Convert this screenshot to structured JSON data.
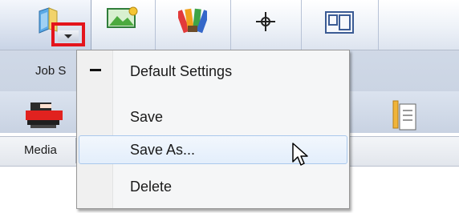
{
  "toolbar": {
    "group_label": "Job S",
    "buttons": [
      {
        "name": "job-settings-icon"
      },
      {
        "name": "image-icon"
      },
      {
        "name": "color-swatch-icon"
      },
      {
        "name": "crosshair-icon"
      },
      {
        "name": "layout-icon"
      }
    ]
  },
  "iconrow": {
    "left_icon": "printer-icon",
    "right_icon": "document-icon"
  },
  "mediarow": {
    "label": "Media"
  },
  "menu": {
    "items": [
      {
        "label": "Default Settings",
        "checked": true
      },
      {
        "label": "Save"
      },
      {
        "label": "Save As...",
        "hovered": true
      },
      {
        "label": "Delete"
      }
    ]
  },
  "colors": {
    "highlight": "#e4141c",
    "hover_border": "#a9c8ec"
  }
}
